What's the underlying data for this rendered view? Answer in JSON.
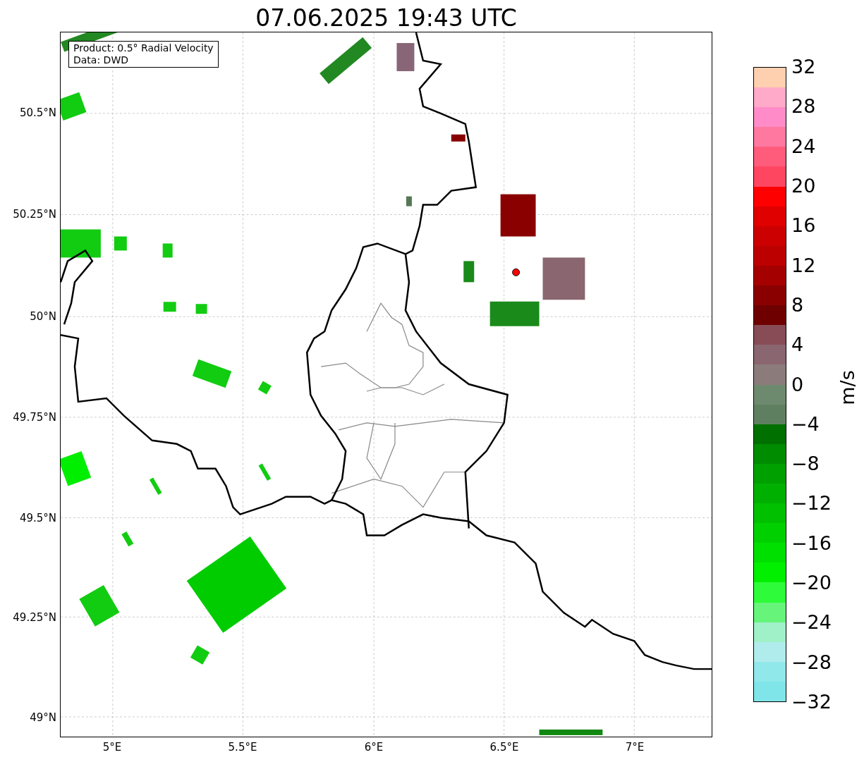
{
  "title": "07.06.2025 19:43 UTC",
  "info_box": [
    "Product: 0.5° Radial Velocity",
    "Data: DWD"
  ],
  "y_ticks": [
    "50.5°N",
    "50.25°N",
    "50°N",
    "49.75°N",
    "49.5°N",
    "49.25°N",
    "49°N"
  ],
  "x_ticks": [
    "5°E",
    "5.5°E",
    "6°E",
    "6.5°E",
    "7°E"
  ],
  "colorbar": {
    "label": "m/s",
    "ticks": [
      "32",
      "28",
      "24",
      "20",
      "16",
      "12",
      "8",
      "4",
      "0",
      "−4",
      "−8",
      "−12",
      "−16",
      "−20",
      "−24",
      "−28",
      "−32"
    ]
  }
}
